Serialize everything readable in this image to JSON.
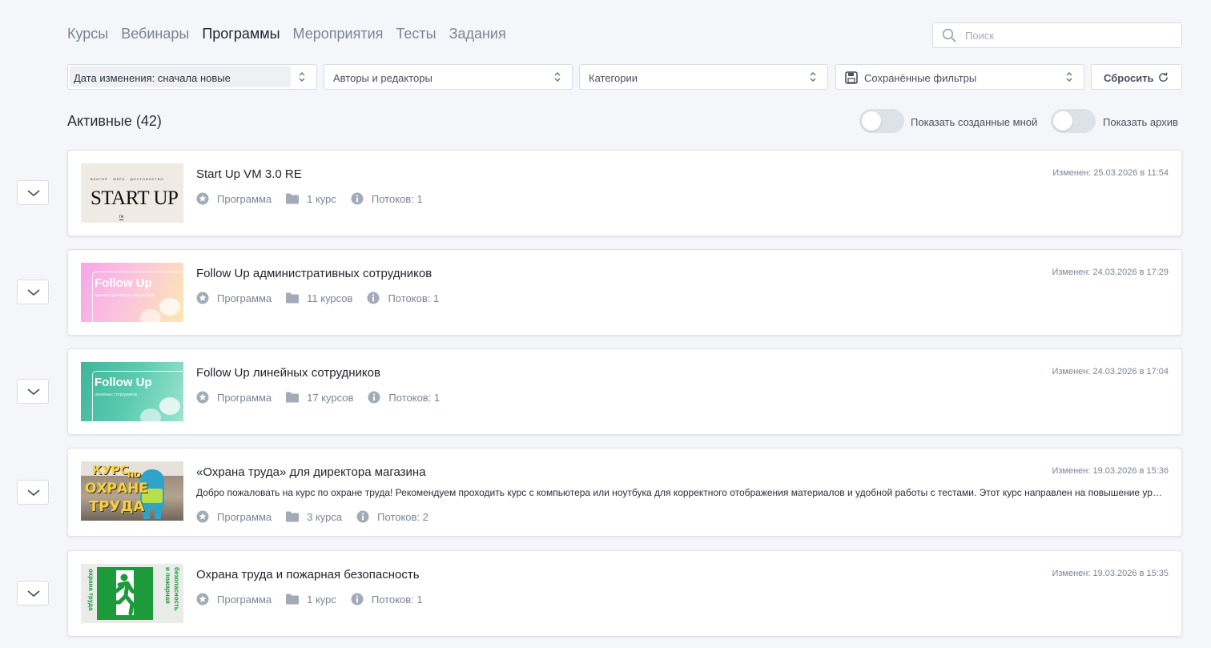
{
  "tabs": [
    {
      "label": "Курсы",
      "active": false
    },
    {
      "label": "Вебинары",
      "active": false
    },
    {
      "label": "Программы",
      "active": true
    },
    {
      "label": "Мероприятия",
      "active": false
    },
    {
      "label": "Тесты",
      "active": false
    },
    {
      "label": "Задания",
      "active": false
    }
  ],
  "search": {
    "placeholder": "Поиск",
    "value": ""
  },
  "filters": {
    "sort": "Дата изменения: сначала новые",
    "authors": "Авторы и редакторы",
    "categories": "Категории",
    "saved": "Сохранённые фильтры",
    "reset": "Сбросить"
  },
  "section": {
    "title": "Активные (42)"
  },
  "toggles": {
    "created_by_me": {
      "label": "Показать созданные мной",
      "on": false
    },
    "archive": {
      "label": "Показать архив",
      "on": false
    }
  },
  "programs": [
    {
      "title": "Start Up VM 3.0 RE",
      "changed": "Изменен: 25.03.2026 в 11:54",
      "description": "",
      "type": "Программа",
      "courses": "1 курс",
      "streams": "Потоков: 1",
      "thumb": {
        "small": "ВЕКТОР · МЕРА · ДОСТОИНСТВО",
        "big": "START UP",
        "logo": "re"
      }
    },
    {
      "title": "Follow Up административных сотрудников",
      "changed": "Изменен: 24.03.2026 в 17:29",
      "description": "",
      "type": "Программа",
      "courses": "11 курсов",
      "streams": "Потоков: 1",
      "thumb": {
        "big": "Follow Up",
        "small": "административных сотрудников"
      }
    },
    {
      "title": "Follow Up линейных сотрудников",
      "changed": "Изменен: 24.03.2026 в 17:04",
      "description": "",
      "type": "Программа",
      "courses": "17 курсов",
      "streams": "Потоков: 1",
      "thumb": {
        "big": "Follow Up",
        "small": "линейных сотрудников"
      }
    },
    {
      "title": "«Охрана труда» для директора магазина",
      "changed": "Изменен: 19.03.2026 в 15:36",
      "description": "Добро пожаловать на курс по охране труда! Рекомендуем проходить курс с компьютера или ноутбука для корректного отображения материалов и удобной работы с тестами. Этот курс направлен на повышение уровня ва...",
      "type": "Программа",
      "courses": "3 курса",
      "streams": "Потоков: 2",
      "thumb": {
        "w1": "КУРС",
        "w2": "ПО",
        "w3": "ОХРАНЕ",
        "w4": "ТРУДА"
      }
    },
    {
      "title": "Охрана труда и пожарная безопасность",
      "changed": "Изменен: 19.03.2026 в 15:35",
      "description": "",
      "type": "Программа",
      "courses": "1 курс",
      "streams": "Потоков: 1",
      "thumb": {
        "left": "охрана труда",
        "right1": "и пожарная",
        "right2": "безопасность"
      }
    }
  ],
  "colors": {
    "accent": "#22262e",
    "muted": "#7a8494",
    "border": "#d7dbe2",
    "background": "#f5f6fa"
  }
}
